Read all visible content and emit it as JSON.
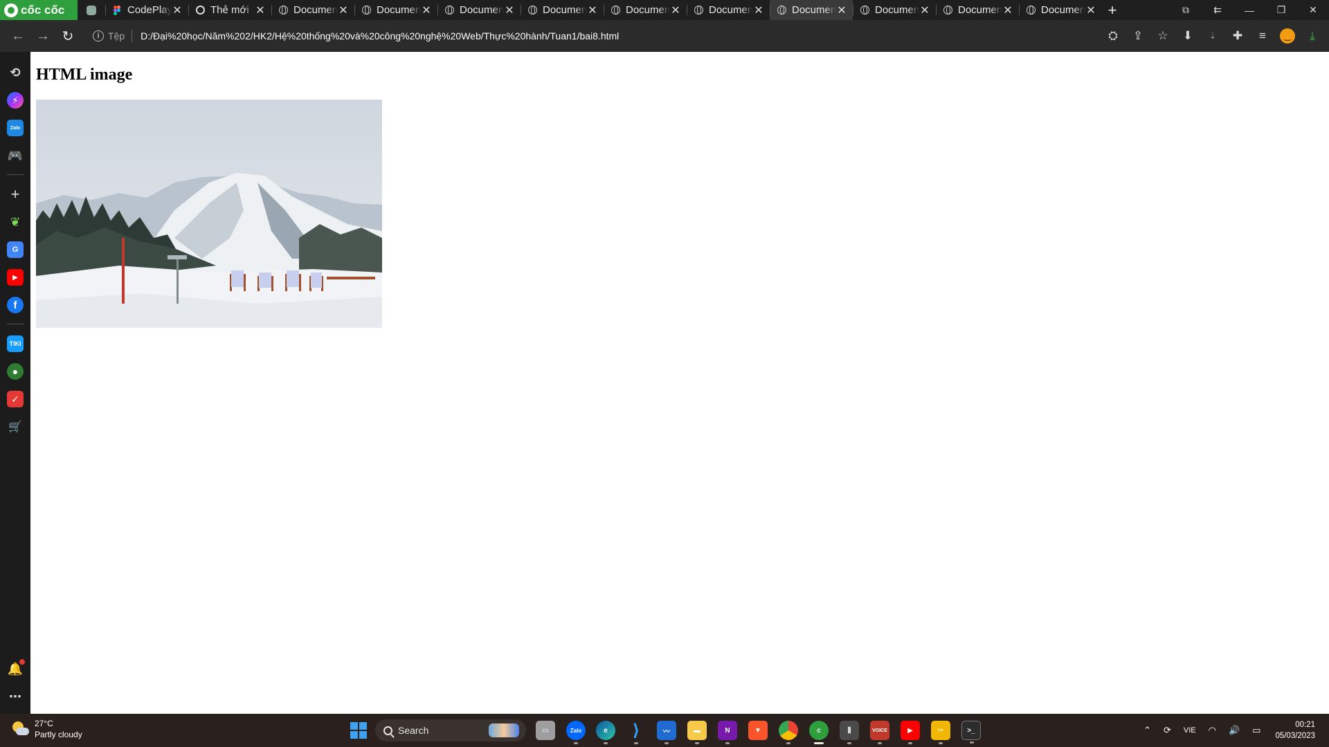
{
  "browser": {
    "brand": "cốc cốc",
    "tabs": [
      {
        "type": "pinned",
        "label": ""
      },
      {
        "type": "normal",
        "label": "CodePlay",
        "favicon": "figma-icon"
      },
      {
        "type": "normal",
        "label": "Thẻ mới",
        "favicon": "coccoc-icon"
      },
      {
        "type": "normal",
        "label": "Documen",
        "favicon": "globe-icon"
      },
      {
        "type": "normal",
        "label": "Documen",
        "favicon": "globe-icon"
      },
      {
        "type": "normal",
        "label": "Documen",
        "favicon": "globe-icon"
      },
      {
        "type": "normal",
        "label": "Documen",
        "favicon": "globe-icon"
      },
      {
        "type": "normal",
        "label": "Documen",
        "favicon": "globe-icon"
      },
      {
        "type": "normal",
        "label": "Documen",
        "favicon": "globe-icon"
      },
      {
        "type": "active",
        "label": "Documen",
        "favicon": "globe-icon"
      },
      {
        "type": "normal",
        "label": "Documen",
        "favicon": "globe-icon"
      },
      {
        "type": "normal",
        "label": "Documen",
        "favicon": "globe-icon"
      },
      {
        "type": "normal",
        "label": "Documen",
        "favicon": "globe-icon"
      }
    ],
    "address": {
      "scheme_label": "Tệp",
      "url": "D:/Đại%20học/Năm%202/HK2/Hệ%20thống%20và%20công%20nghệ%20Web/Thực%20hành/Tuan1/bai8.html"
    }
  },
  "page": {
    "heading": "HTML image"
  },
  "taskbar": {
    "weather_temp": "27°C",
    "weather_desc": "Partly cloudy",
    "search_label": "Search",
    "language": "VIE",
    "time": "00:21",
    "date": "05/03/2023"
  },
  "colors": {
    "brand_green": "#2f9e3c",
    "tabstrip_bg": "#1f1f1f",
    "toolbar_bg": "#2b2b2b",
    "sidebar_bg": "#1c1c1c",
    "taskbar_bg": "#2a211e"
  }
}
